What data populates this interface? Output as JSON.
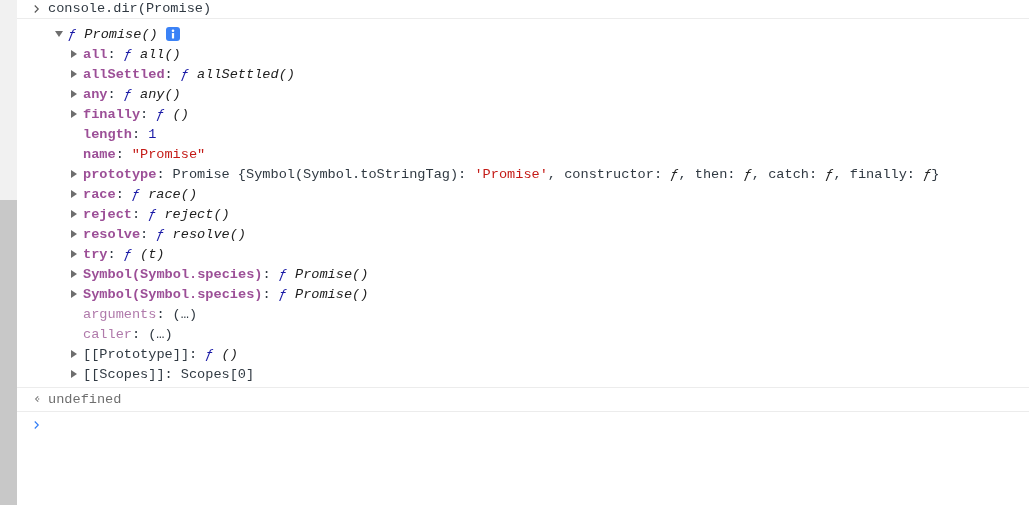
{
  "console": [
    {
      "kind": "input",
      "text": "console.dir(Promise)"
    },
    {
      "kind": "tree",
      "root": {
        "expanded": true,
        "value": [
          {
            "kind": "f",
            "text": "ƒ"
          },
          {
            "kind": "fname",
            "text": " Promise()"
          }
        ],
        "info": true,
        "children": [
          {
            "key": "all",
            "sep": ":",
            "dimmed": false,
            "expanded": false,
            "value": [
              {
                "kind": "f",
                "text": "ƒ"
              },
              {
                "kind": "fname",
                "text": " all()"
              }
            ]
          },
          {
            "key": "allSettled",
            "sep": ":",
            "dimmed": false,
            "expanded": false,
            "value": [
              {
                "kind": "f",
                "text": "ƒ"
              },
              {
                "kind": "fname",
                "text": " allSettled()"
              }
            ]
          },
          {
            "key": "any",
            "sep": ":",
            "dimmed": false,
            "expanded": false,
            "value": [
              {
                "kind": "f",
                "text": "ƒ"
              },
              {
                "kind": "fname",
                "text": " any()"
              }
            ]
          },
          {
            "key": "finally",
            "sep": ":",
            "dimmed": false,
            "expanded": false,
            "value": [
              {
                "kind": "f",
                "text": "ƒ"
              },
              {
                "kind": "fname",
                "text": " ()"
              }
            ]
          },
          {
            "key": "length",
            "sep": ":",
            "dimmed": false,
            "value": [
              {
                "kind": "number",
                "text": "1"
              }
            ]
          },
          {
            "key": "name",
            "sep": ":",
            "dimmed": false,
            "value": [
              {
                "kind": "string",
                "text": "\"Promise\""
              }
            ]
          },
          {
            "key": "prototype",
            "sep": ":",
            "dimmed": false,
            "expanded": false,
            "value": [
              {
                "kind": "plain",
                "text": "Promise {Symbol(Symbol.toStringTag): "
              },
              {
                "kind": "string",
                "text": "'Promise'"
              },
              {
                "kind": "plain",
                "text": ", constructor: "
              },
              {
                "kind": "fplain",
                "text": "ƒ"
              },
              {
                "kind": "plain",
                "text": ", then: "
              },
              {
                "kind": "fplain",
                "text": "ƒ"
              },
              {
                "kind": "plain",
                "text": ", catch: "
              },
              {
                "kind": "fplain",
                "text": "ƒ"
              },
              {
                "kind": "plain",
                "text": ", finally: "
              },
              {
                "kind": "fplain",
                "text": "ƒ"
              },
              {
                "kind": "plain",
                "text": "}"
              }
            ]
          },
          {
            "key": "race",
            "sep": ":",
            "dimmed": false,
            "expanded": false,
            "value": [
              {
                "kind": "f",
                "text": "ƒ"
              },
              {
                "kind": "fname",
                "text": " race()"
              }
            ]
          },
          {
            "key": "reject",
            "sep": ":",
            "dimmed": false,
            "expanded": false,
            "value": [
              {
                "kind": "f",
                "text": "ƒ"
              },
              {
                "kind": "fname",
                "text": " reject()"
              }
            ]
          },
          {
            "key": "resolve",
            "sep": ":",
            "dimmed": false,
            "expanded": false,
            "value": [
              {
                "kind": "f",
                "text": "ƒ"
              },
              {
                "kind": "fname",
                "text": " resolve()"
              }
            ]
          },
          {
            "key": "try",
            "sep": ":",
            "dimmed": false,
            "expanded": false,
            "value": [
              {
                "kind": "f",
                "text": "ƒ"
              },
              {
                "kind": "fname",
                "text": " (t)"
              }
            ]
          },
          {
            "key": "Symbol(Symbol.species)",
            "sep": ":",
            "dimmed": false,
            "expanded": false,
            "value": [
              {
                "kind": "f",
                "text": "ƒ"
              },
              {
                "kind": "fname",
                "text": " Promise()"
              }
            ]
          },
          {
            "key": "Symbol(Symbol.species)",
            "sep": ":",
            "dimmed": false,
            "expanded": false,
            "value": [
              {
                "kind": "f",
                "text": "ƒ"
              },
              {
                "kind": "fname",
                "text": " Promise()"
              }
            ]
          },
          {
            "key": "arguments",
            "sep": ":",
            "dimmed": true,
            "value": [
              {
                "kind": "plain",
                "text": "(…)"
              }
            ]
          },
          {
            "key": "caller",
            "sep": ":",
            "dimmed": true,
            "value": [
              {
                "kind": "plain",
                "text": "(…)"
              }
            ]
          },
          {
            "key": "[[Prototype]]",
            "sep": ":",
            "internal": true,
            "dimmed": false,
            "expanded": false,
            "value": [
              {
                "kind": "f",
                "text": "ƒ"
              },
              {
                "kind": "fname",
                "text": " ()"
              }
            ]
          },
          {
            "key": "[[Scopes]]",
            "sep": ":",
            "internal": true,
            "dimmed": false,
            "expanded": false,
            "value": [
              {
                "kind": "plain",
                "text": "Scopes[0]"
              }
            ]
          }
        ]
      }
    },
    {
      "kind": "result",
      "text": "undefined"
    },
    {
      "kind": "prompt"
    }
  ]
}
